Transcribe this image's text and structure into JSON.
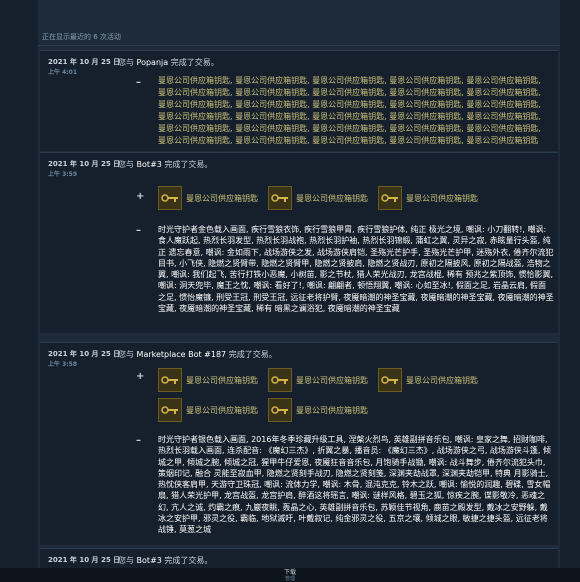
{
  "top_note": "正在显示最近的 6 次活动",
  "trades": [
    {
      "date": "2021 年 10 月 25 日",
      "time": "上午 4:01",
      "prefix": "您与",
      "user": "Popanja",
      "suffix": "完成了交易。",
      "given_sign": "–",
      "given_text": "曼恩公司供应箱钥匙, 曼恩公司供应箱钥匙, 曼恩公司供应箱钥匙, 曼恩公司供应箱钥匙, 曼恩公司供应箱钥匙, 曼恩公司供应箱钥匙, 曼恩公司供应箱钥匙, 曼恩公司供应箱钥匙, 曼恩公司供应箱钥匙, 曼恩公司供应箱钥匙, 曼恩公司供应箱钥匙, 曼恩公司供应箱钥匙, 曼恩公司供应箱钥匙, 曼恩公司供应箱钥匙, 曼恩公司供应箱钥匙, 曼恩公司供应箱钥匙, 曼恩公司供应箱钥匙, 曼恩公司供应箱钥匙, 曼恩公司供应箱钥匙, 曼恩公司供应箱钥匙, 曼恩公司供应箱钥匙, 曼恩公司供应箱钥匙, 曼恩公司供应箱钥匙, 曼恩公司供应箱钥匙, 曼恩公司供应箱钥匙, 曼恩公司供应箱钥匙, 曼恩公司供应箱钥匙, 曼恩公司供应箱钥匙, 曼恩公司供应箱钥匙, 曼恩公司供应箱钥匙"
    },
    {
      "date": "2021 年 10 月 25 日",
      "time": "上午 3:59",
      "prefix": "您与",
      "user": "Bot#3",
      "suffix": "完成了交易。",
      "received_sign": "+",
      "received_items": [
        "曼恩公司供应箱钥匙",
        "曼恩公司供应箱钥匙",
        "曼恩公司供应箱钥匙"
      ],
      "given_sign": "–",
      "given_desc": "时光守护者金色载入画面, 疾行雪狼衣饰, 疾行雪狼甲胄, 疾行雪狼护体, 纯正 极光之境, 嘲讽: 小刀翻转!, 嘲讽: 食人魔跃起, 热烈长羽发型, 热烈长羽战袍, 热烈长羽护袖, 热烈长羽锦缎, 蒲虹之翼, 灵异之寂, 赤眩量行头盔, 纯正 遗忘春意, 嘲讽: 金如雨下, 战场游侠之发, 战场游侠肩铠, 圣殇光芒护手, 圣殇光芒护甲, 迷殇外衣, 倦齐尔流犯目书, 小飞侠, 隐燃之贤臂带, 隐燃之贤臂甲, 隐燃之贤披肩, 隐燃之贤战刃, 原初之隔披风, 原初之隔战盔, 浩物之翼, 嘲讽: 我们起飞, 苦行打铁小恶魔, 小树苗, 影之节杖, 猎人荣光战刃, 龙宫战棍, 稀有 预兆之紫顶饰, 惯恰影翼, 嘲讽: 洞天兜毕, 魔王之忱, 嘲讽: 看好了!, 嘲讽: 翩翩者, 顿悟翔翼, 嘲讽: 心如至冰!, 假面之足, 岩晶云肩, 假面之足, 惯怡魔镰, 刑受王冠, 刑受王冠, 远征老将护臂, 夜魇暗潮的神圣宝藏, 夜魇暗潮的神圣宝藏, 夜魇暗潮的神圣宝藏, 夜魇暗潮的神圣宝藏, 稀有 暗黑之谰浴犯, 夜魇暗潮的神圣宝藏"
    },
    {
      "date": "2021 年 10 月 25 日",
      "time": "上午 3:58",
      "prefix": "您与",
      "user": "Marketplace Bot #187",
      "suffix": "完成了交易。",
      "received_sign": "+",
      "received_items": [
        "曼恩公司供应箱钥匙",
        "曼恩公司供应箱钥匙",
        "曼恩公司供应箱钥匙",
        "曼恩公司供应箱钥匙",
        "曼恩公司供应箱钥匙"
      ],
      "given_sign": "–",
      "given_desc": "时光守护者银色载入画面, 2016年冬季珍藏升级工具, 涅槃火烈鸟, 英雄副拼音乐包, 嘲讽: 皇家之舞, 招财咖啡, 热烈长羽载入画面, 连杀配音: 《魔幻三杰》, 折翼之暴, 播音员: 《魔幻三杰》, 战场游侠之弓, 战场游侠斗篷, 倾城之甲, 倾城之腕, 倾城之冠, 猩甲牛仔爱恩, 夜魇狂音音乐包, 月饱骑手战锄, 嘲讽: 战斗舞步, 倦齐尔流犯头巾, 策烟印记, 融合 灵能至寂血甲, 隐燃之贤刻手战刃, 隐燃之贤刻笺, 深渊夹劫战罩, 深渊夹劫铠甲, 特典 月影骑士, 热忱侠客肩甲, 天游守卫珠冠, 嘲讽: 流体力学, 嘲讽: 木骨, 混沌克克, 铃木之跃, 嘲讽: 愉悦的润趣, 碧碟, 雪女帽扇, 猎人荣光护甲, 龙宫战盔, 龙宫护肩, 醉酒这将瑶言, 嘲讽: 谜样风格, 碧玉之狐, 惊疾之腕, 谍影敬冷, 恶魂之幻, 亢人之诚, 灼霸之痕, 九巖夜眺, 轰晶之心, 英雄副拼音乐包, 苏颖佳节视角, 鹿苗之殿发型, 戴冰之安野躲, 戴冰之安护甲, 邪灵之役, 霸临, 地狱滅吁, 叶戴叙记, 纯金邪灵之役, 五京之壤, 倾城之眼, 敏捷之捷头盔, 远征老将战锤, 莫葱之城"
    }
  ],
  "partial_trade": {
    "date": "2021 年 10 月 25 日",
    "prefix": "您与",
    "user": "Bot#3",
    "suffix": "完成了交易。"
  },
  "footer": {
    "download_label": "下载",
    "manage_label": "管理"
  }
}
